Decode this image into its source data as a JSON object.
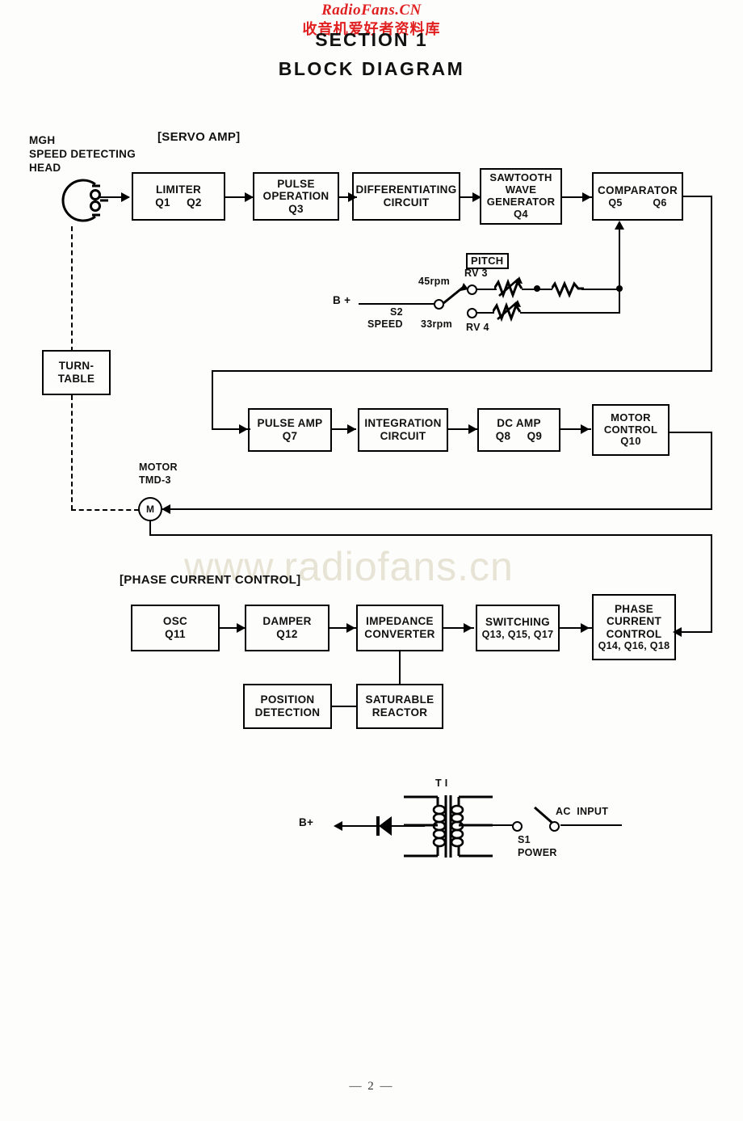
{
  "watermark": {
    "top_line1": "RadioFans.CN",
    "top_line2": "收音机爱好者资料库",
    "body": "www.radiofans.cn",
    "color": "#e02020"
  },
  "header": {
    "section": "SECTION  1",
    "title": "BLOCK  DIAGRAM"
  },
  "page_number": "— 2 —",
  "labels": {
    "mgh": "MGH\nSPEED DETECTING\nHEAD",
    "servo_amp": "[SERVO AMP]",
    "phase_current_control": "[PHASE CURRENT CONTROL]",
    "pitch": "PITCH",
    "b_plus_top": "B +",
    "b_plus_psu": "B+",
    "s2": "S2",
    "speed": "SPEED",
    "rpm45": "45rpm",
    "rpm33": "33rpm",
    "rv3": "RV 3",
    "rv4": "RV 4",
    "motor_name": "MOTOR",
    "motor_model": "TMD-3",
    "motor_symbol": "M",
    "t1": "T I",
    "s1": "S1",
    "power": "POWER",
    "ac_input": "AC  INPUT"
  },
  "blocks": {
    "limiter": {
      "line1": "LIMITER",
      "line2": "Q1     Q2"
    },
    "pulse_operation": {
      "line1": "PULSE",
      "line2": "OPERATION",
      "line3": "Q3"
    },
    "differentiating": {
      "line1": "DIFFERENTIATING",
      "line2": "CIRCUIT"
    },
    "sawtooth": {
      "line1": "SAWTOOTH",
      "line2": "WAVE",
      "line3": "GENERATOR",
      "line4": "Q4"
    },
    "comparator": {
      "line1": "COMPARATOR",
      "line2": "Q5          Q6"
    },
    "turntable": {
      "line1": "TURN-",
      "line2": "TABLE"
    },
    "pulse_amp": {
      "line1": "PULSE  AMP",
      "line2": "Q7"
    },
    "integration": {
      "line1": "INTEGRATION",
      "line2": "CIRCUIT"
    },
    "dc_amp": {
      "line1": "DC  AMP",
      "line2": "Q8     Q9"
    },
    "motor_control": {
      "line1": "MOTOR",
      "line2": "CONTROL",
      "line3": "Q10"
    },
    "osc": {
      "line1": "OSC",
      "line2": "Q11"
    },
    "damper": {
      "line1": "DAMPER",
      "line2": "Q12"
    },
    "impedance": {
      "line1": "IMPEDANCE",
      "line2": "CONVERTER"
    },
    "switching": {
      "line1": "SWITCHING",
      "line2": "Q13, Q15, Q17"
    },
    "phase_current": {
      "line1": "PHASE",
      "line2": "CURRENT",
      "line3": "CONTROL",
      "line4": "Q14, Q16, Q18"
    },
    "position_detection": {
      "line1": "POSITION",
      "line2": "DETECTION"
    },
    "saturable_reactor": {
      "line1": "SATURABLE",
      "line2": "REACTOR"
    }
  }
}
